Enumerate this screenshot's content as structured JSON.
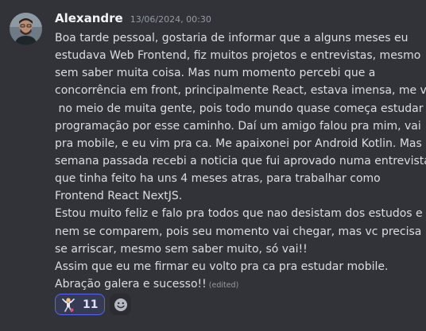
{
  "message": {
    "author": "Alexandre",
    "timestamp": "13/06/2024, 00:30",
    "lines": [
      "Boa tarde pessoal, gostaria de informar que a alguns meses eu",
      "estudava Web Frontend, fiz muitos projetos e entrevistas, mesmo",
      "sem saber muita coisa. Mas num momento percebi que a",
      "concorrência em front, principalmente React, estava imensa, me vi",
      " no meio de muita gente, pois todo mundo quase começa estudar",
      "programação por esse caminho. Daí um amigo falou pra mim, vai",
      "pra mobile, e eu vim pra ca. Me apaixonei por Android Kotlin. Mas",
      "semana passada recebi a noticia que fui aprovado numa entrevista",
      "que tinha feito ha uns 4 meses atras, para trabalhar como",
      "Frontend React NextJS.",
      "Estou muito feliz e falo pra todos que nao desistam dos estudos e",
      "nem se comparem, pois seu momento vai chegar, mas vc precisa",
      "se arriscar, mesmo sem saber muito, só vai!!",
      "Assim que eu me firmar eu volto pra ca pra estudar mobile.",
      "Abração galera e sucesso!!"
    ],
    "edited_label": "(edited)"
  },
  "reactions": [
    {
      "emoji_icon": "dancing-person-emoji-icon",
      "count": "11",
      "selected": true
    }
  ],
  "add_reaction_icon": "smiley-add-reaction-icon",
  "colors": {
    "background": "#313338",
    "text": "#dbdee1",
    "username": "#f2f3f5",
    "muted": "#949ba4",
    "accent": "#5865f2"
  }
}
